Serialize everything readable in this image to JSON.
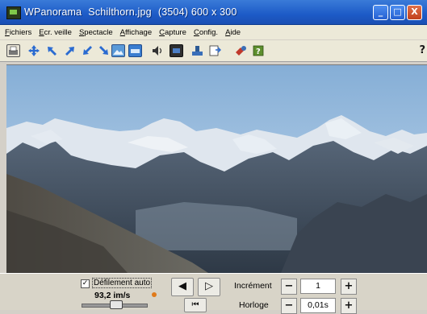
{
  "window": {
    "title_app": "WPanorama",
    "title_file": "Schilthorn.jpg",
    "title_info": "(3504)  600 x 300",
    "buttons": {
      "minimize": "_",
      "maximize": "□",
      "close": "X"
    }
  },
  "menu": {
    "items": [
      {
        "underline": "F",
        "rest": "ichiers"
      },
      {
        "underline": "E",
        "rest": "cr. veille"
      },
      {
        "underline": "S",
        "rest": "pectacle"
      },
      {
        "underline": "A",
        "rest": "ffichage"
      },
      {
        "underline": "C",
        "rest": "apture"
      },
      {
        "underline": "C",
        "rest": "onfig."
      },
      {
        "underline": "A",
        "rest": "ide"
      }
    ]
  },
  "toolbar": {
    "help_label": "?"
  },
  "controls": {
    "auto_scroll_label": "Défilement auto",
    "auto_scroll_checked": "✓",
    "speed": "93,2 im/s",
    "slider_value": 0.52,
    "prev_label": "◀",
    "next_label": "▷",
    "rewind_label": "⏮",
    "increment_label": "Incrément",
    "increment_value": "1",
    "clock_label": "Horloge",
    "clock_value": "0,01s",
    "minus": "−",
    "plus": "+"
  },
  "colors": {
    "titlebar": "#1d5bc7",
    "sky": "#9cc0e2",
    "accent_orange": "#e07a1a"
  }
}
